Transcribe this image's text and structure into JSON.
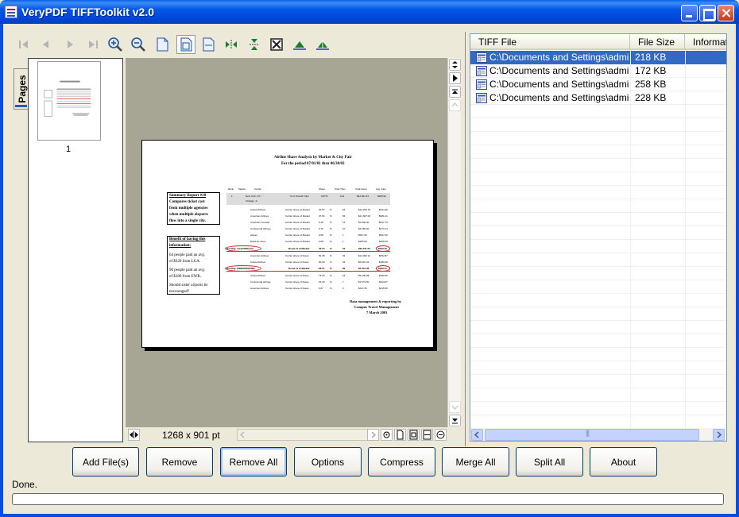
{
  "window": {
    "title": "VeryPDF TIFFToolkit v2.0"
  },
  "toolbar": {
    "icons": [
      "first-page-icon",
      "prev-page-icon",
      "next-page-icon",
      "last-page-icon",
      "zoom-in-icon",
      "zoom-out-icon",
      "actual-size-icon",
      "fit-page-icon",
      "fit-width-icon",
      "flip-horizontal-icon",
      "flip-vertical-icon",
      "crop-icon",
      "rotate-left-icon",
      "rotate-right-icon"
    ]
  },
  "pages_panel": {
    "tab_label": "Pages",
    "thumb_label": "1"
  },
  "viewer": {
    "dimensions": "1268 x 901 pt"
  },
  "document": {
    "title": "Airline Share Analysis by Market & City Pair",
    "period": "For the period 07/01/01 thru 06/30/02",
    "summary": "Summary Report #10",
    "summary_text": [
      "Compares ticket cost",
      "from multiple agencies",
      "when multiple airports",
      "flow into a single city."
    ],
    "benefit": [
      "Benefit of having this",
      "information:"
    ],
    "notes": [
      "64 people paid an avg.",
      "of $320 from LGA.",
      "",
      "90 people paid an avg.",
      "of $180 from EWR.",
      "",
      "Should sister airports be",
      "encouraged?"
    ],
    "footer": [
      "Data management & reporting by",
      "Campus Travel Management",
      "7 March 2003"
    ],
    "col_heads": [
      "Rank",
      "Market",
      "Carrier",
      "Share",
      "Total Trips",
      "Total Fares",
      "Avg. Fare"
    ],
    "market_row": [
      "1",
      "New York, NY /",
      "% of Overall Trips",
      "3.87%",
      "144",
      "$42,021.33",
      "$283.92"
    ],
    "market_row2": "Chicago, IL",
    "rows_a": [
      [
        "United Airlines",
        "Carrier share of Market",
        "42.57",
        "63",
        "$12,294.79",
        "$194.49"
      ],
      [
        "American Airlines",
        "Carrier share of Market",
        "37.84",
        "56",
        "$21,607.06",
        "$381.21"
      ],
      [
        "American Transair",
        "Carrier share of Market",
        "9.46",
        "14",
        "$1,936.30",
        "$317.73"
      ],
      [
        "Continental Airlines",
        "Carrier share of Market",
        "6.76",
        "10",
        "$3,350.00",
        "$273.14"
      ],
      [
        "Airtran",
        "Carrier share of Market",
        "0.68",
        "1",
        "$527.00",
        "$527.00"
      ],
      [
        "Delta Air Lines",
        "Carrier share of Market",
        "0.68",
        "1",
        "$255.00",
        "$255.00"
      ]
    ],
    "route_1": [
      "Routing: LGA/ORD/LGA",
      "Route % of Market:",
      "43.24",
      "64",
      "$20,511.53",
      "$320.49"
    ],
    "rows_b": [
      [
        "American Airlines",
        "Carrier share of Route",
        "59.38",
        "32",
        "$14,492.12",
        "$452.87"
      ],
      [
        "United Airlines",
        "Carrier share of Route",
        "50.00",
        "32",
        "$6,001.41",
        "$189.48"
      ]
    ],
    "route_2": [
      "Routing: EWR/ORD/EWR",
      "Route % of Market:",
      "26.57",
      "90",
      "$5,412.36",
      "$180.41"
    ],
    "rows_c": [
      [
        "United Airlines",
        "Carrier share of Route",
        "73.33",
        "21",
        "$5,430.08",
        "$182.50"
      ],
      [
        "Continental Airlines",
        "Carrier share of Route",
        "23.33",
        "7",
        "$1,572.50",
        "$224.07"
      ],
      [
        "American Airlines",
        "Carrier share of Route",
        "6.67",
        "2",
        "$417.00",
        "$215.50"
      ]
    ]
  },
  "file_list": {
    "columns": [
      "TIFF File",
      "File Size",
      "Informati"
    ],
    "rows": [
      {
        "file": "C:\\Documents and Settings\\admin...",
        "size": "218 KB",
        "selected": true
      },
      {
        "file": "C:\\Documents and Settings\\admin...",
        "size": "172 KB",
        "selected": false
      },
      {
        "file": "C:\\Documents and Settings\\admin...",
        "size": "258 KB",
        "selected": false
      },
      {
        "file": "C:\\Documents and Settings\\admin...",
        "size": "228 KB",
        "selected": false
      }
    ]
  },
  "buttons": {
    "add_files": "Add File(s)",
    "remove": "Remove",
    "remove_all": "Remove All",
    "options": "Options",
    "compress": "Compress",
    "merge_all": "Merge All",
    "split_all": "Split All",
    "about": "About"
  },
  "status": {
    "text": "Done.",
    "progress": 0
  },
  "colors": {
    "title_bar": "#0055e5",
    "selection": "#316ac5",
    "viewer_bg": "#a7a594",
    "face": "#ece9d8"
  }
}
